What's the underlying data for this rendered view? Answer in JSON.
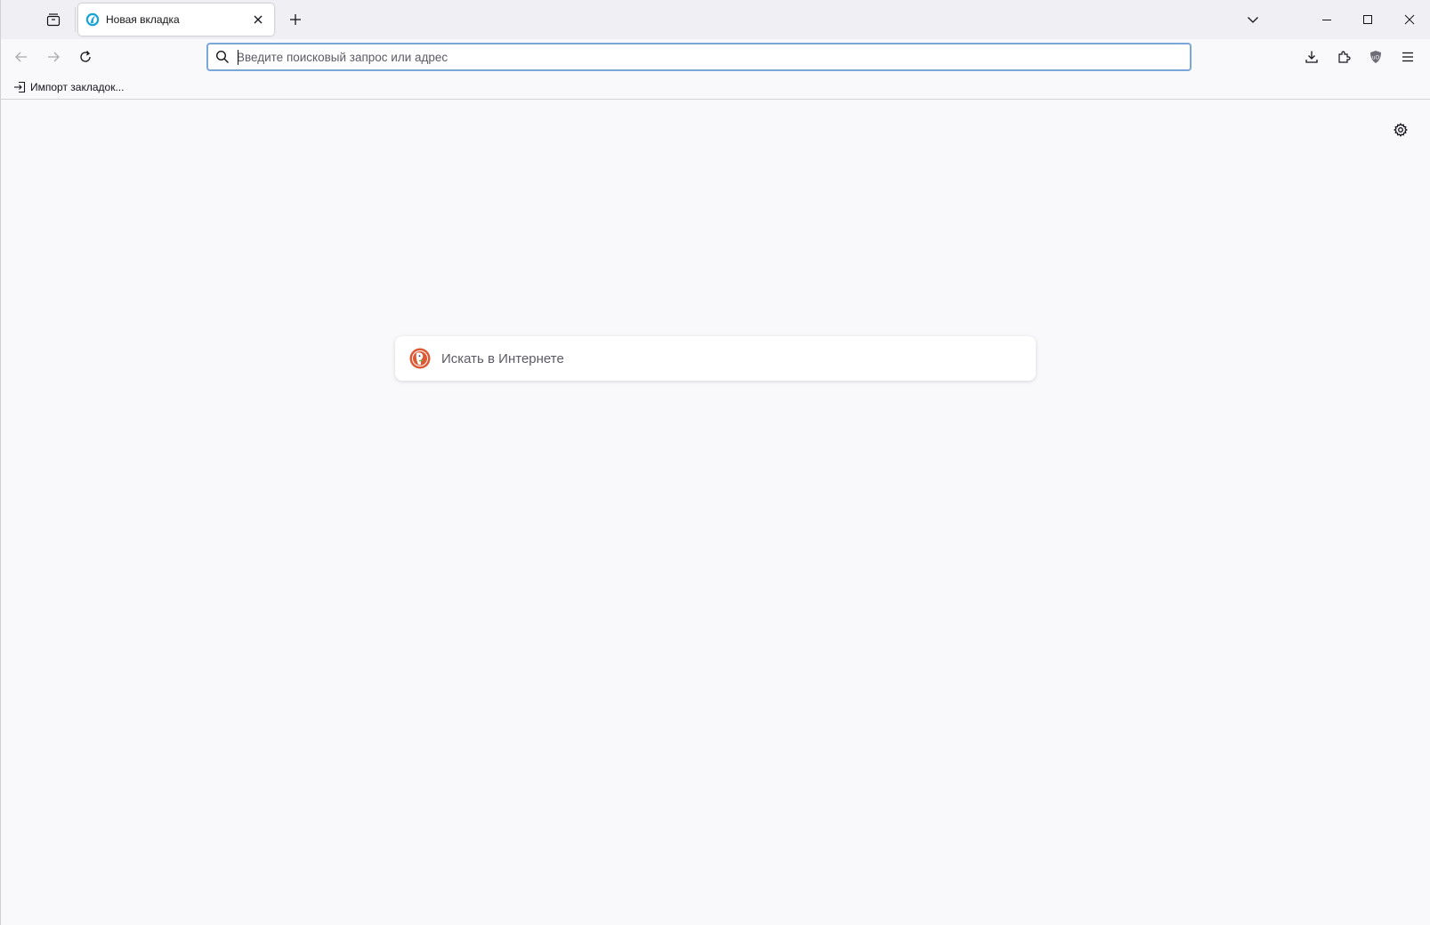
{
  "tab": {
    "title": "Новая вкладка"
  },
  "urlbar": {
    "placeholder": "Введите поисковый запрос или адрес",
    "value": ""
  },
  "bookmarks": {
    "import_label": "Импорт закладок..."
  },
  "newtab": {
    "search_placeholder": "Искать в Интернете",
    "engine_icon": "duckduckgo-icon"
  },
  "icons": {
    "tab_list": "tab-list-icon",
    "tab_favicon": "firefox-icon",
    "tab_close": "close-icon",
    "new_tab": "plus-icon",
    "all_tabs": "chevron-down-icon",
    "minimize": "minimize-icon",
    "maximize": "maximize-icon",
    "close_window": "close-icon",
    "back": "arrow-left-icon",
    "forward": "arrow-right-icon",
    "reload": "reload-icon",
    "search": "search-icon",
    "downloads": "download-icon",
    "extensions": "puzzle-icon",
    "shield": "ublock-shield-icon",
    "menu": "hamburger-menu-icon",
    "import": "import-icon",
    "settings": "gear-icon"
  },
  "colors": {
    "tabstrip_bg": "#f0f0f4",
    "page_bg": "#f9f9fb",
    "urlbar_focus_border": "#7aa7d9",
    "text": "#15141a",
    "placeholder": "#5b5b66"
  }
}
